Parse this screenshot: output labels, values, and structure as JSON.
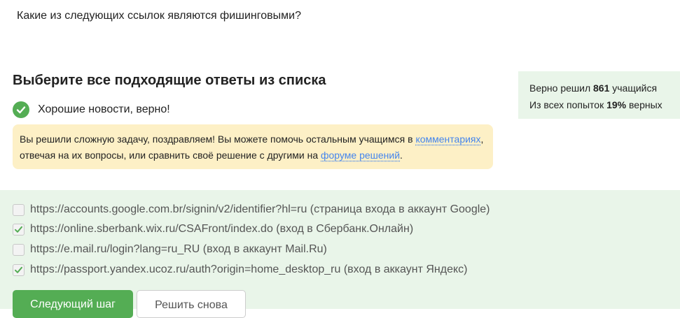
{
  "question": "Какие из следующих ссылок являются фишинговыми?",
  "heading": "Выберите все подходящие ответы из списка",
  "status": {
    "text": "Хорошие новости, верно!"
  },
  "notice": {
    "text1": "Вы решили сложную задачу, поздравляем! Вы можете помочь остальным учащимся в",
    "link1": "комментариях",
    "text2": ", отвечая на их вопросы, или сравнить своё решение с другими на",
    "link2": "форуме решений",
    "text3": "."
  },
  "stats": {
    "solved_prefix": "Верно решил",
    "solved_count": "861",
    "solved_suffix": "учащийся",
    "attempts_prefix": "Из всех попыток",
    "attempts_percent": "19%",
    "attempts_suffix": "верных"
  },
  "options": [
    {
      "label": "https://accounts.google.com.br/signin/v2/identifier?hl=ru (страница входа в аккаунт Google)",
      "checked": false
    },
    {
      "label": "https://online.sberbank.wix.ru/CSAFront/index.do (вход в Сбербанк.Онлайн)",
      "checked": true
    },
    {
      "label": "https://e.mail.ru/login?lang=ru_RU (вход в аккаунт Mail.Ru)",
      "checked": false
    },
    {
      "label": "https://passport.yandex.ucoz.ru/auth?origin=home_desktop_ru (вход в аккаунт Яндекс)",
      "checked": true
    }
  ],
  "buttons": {
    "next": "Следующий шаг",
    "retry": "Решить снова"
  },
  "colors": {
    "accent_green": "#54ad54",
    "notice_bg": "#fdf0c6",
    "panel_bg": "#e9f5e9",
    "link": "#4485ed"
  }
}
